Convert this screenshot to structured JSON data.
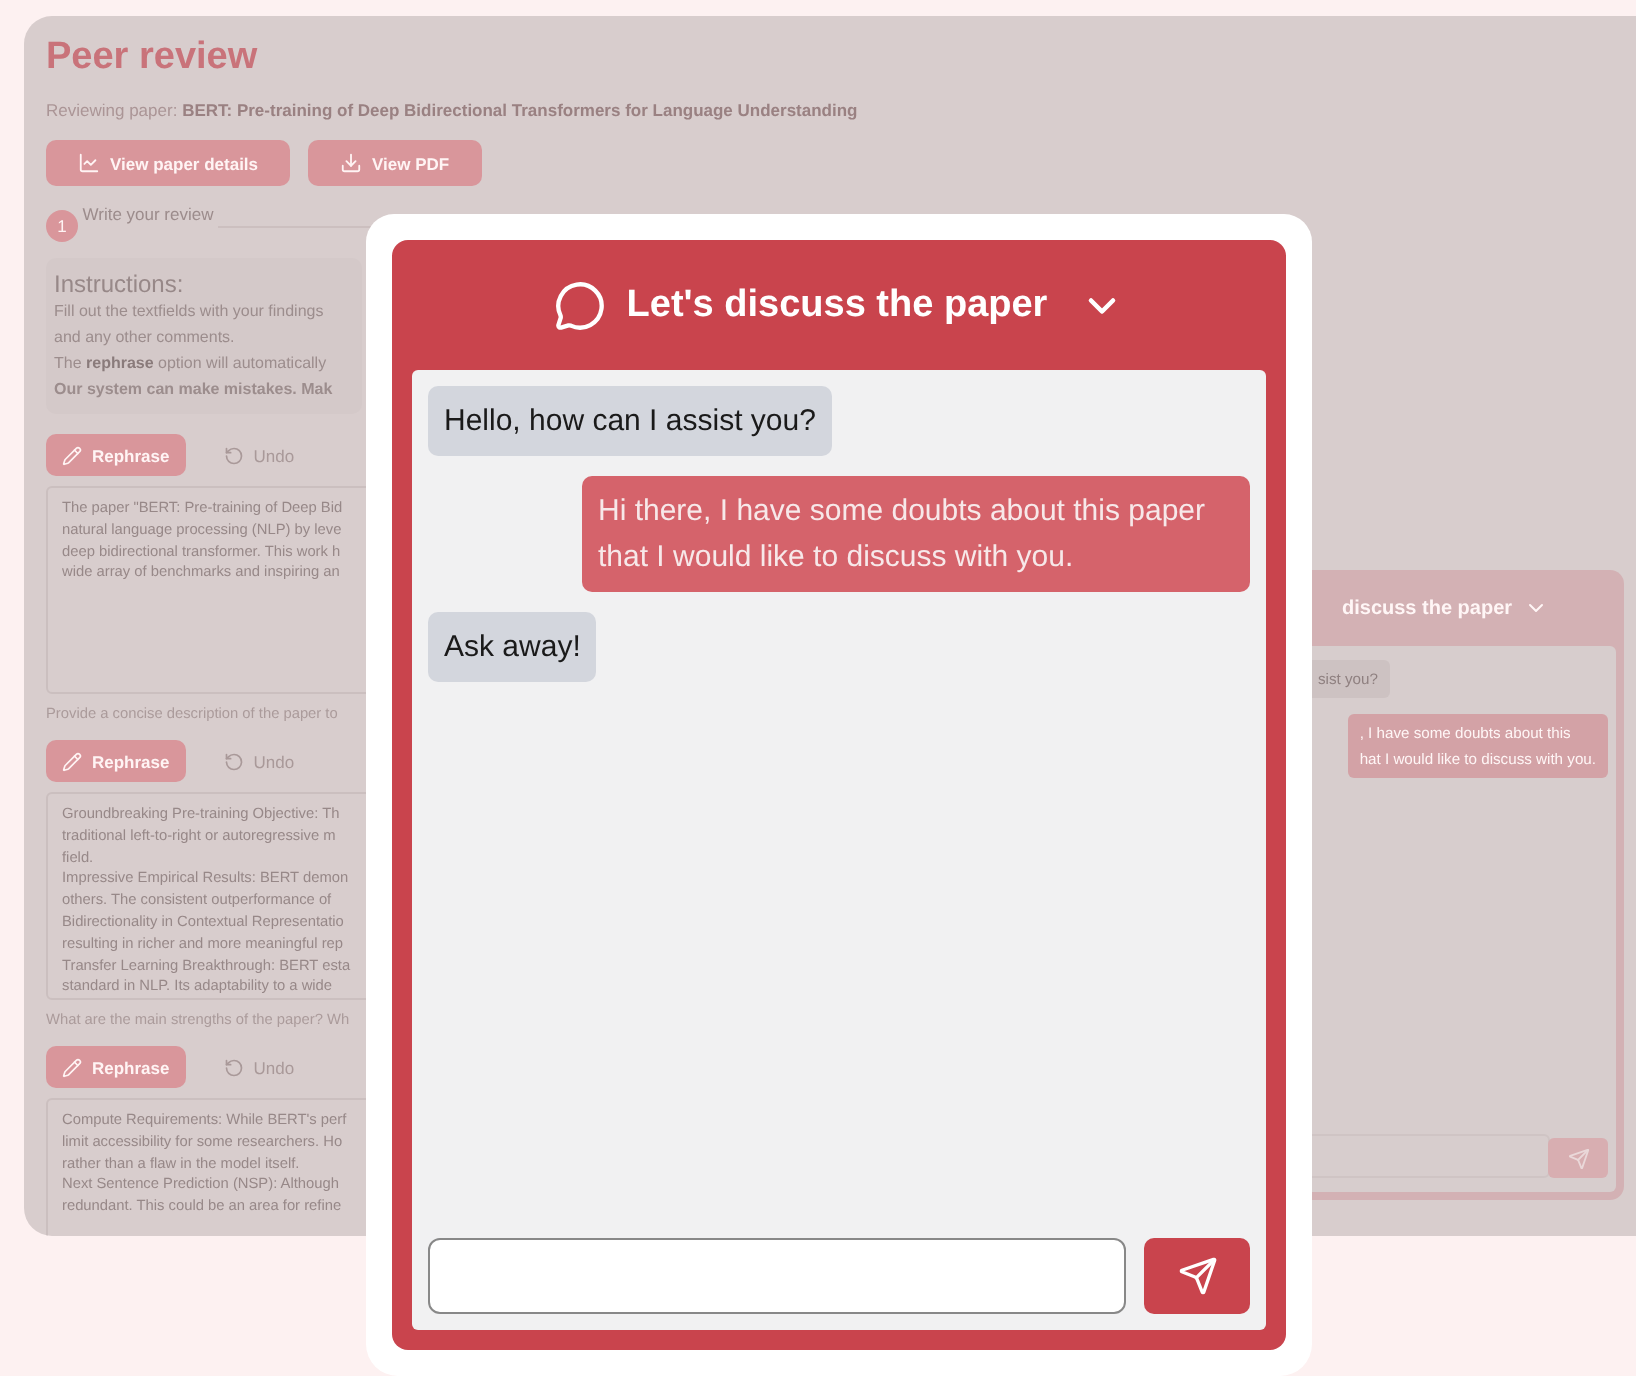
{
  "page": {
    "title": "Peer review",
    "subtitle": {
      "label": "Reviewing paper:",
      "paper": "BERT: Pre-training of Deep Bidirectional Transformers for Language Understanding"
    },
    "buttons": [
      {
        "kind": "chart",
        "label": "View paper details"
      },
      {
        "kind": "download",
        "label": "View PDF"
      }
    ],
    "steps": [
      {
        "number": "1",
        "label": "Write your review"
      }
    ],
    "instructions": {
      "heading": "Instructions:",
      "lines": [
        {
          "text": "Fill out the textfields with your findings",
          "bold": false
        },
        {
          "text": "and any other comments.",
          "bold": false
        },
        {
          "text": "The **rephrase** option will automatically",
          "bold": false
        },
        {
          "text": "Our system can make mistakes. Mak",
          "bold": true
        }
      ]
    },
    "sections": [
      {
        "rephrase": "Rephrase",
        "undo": "Undo",
        "lines": [
          "The paper \"BERT: Pre-training of Deep Bid",
          "natural language processing (NLP) by leve",
          "deep bidirectional transformer. This work h",
          "wide array of benchmarks and inspiring an"
        ],
        "hint": "Provide a concise description of the paper to"
      },
      {
        "rephrase": "Rephrase",
        "undo": "Undo",
        "lines": [
          "Groundbreaking Pre-training Objective: Th",
          "traditional left-to-right or autoregressive m",
          "field.",
          "Impressive Empirical Results: BERT demon",
          "others. The consistent outperformance of",
          "Bidirectionality in Contextual Representatio",
          "resulting in richer and more meaningful rep",
          "Transfer Learning Breakthrough: BERT esta",
          "standard in NLP. Its adaptability to a wide"
        ],
        "hint": "What are the main strengths of the paper? Wh"
      },
      {
        "rephrase": "Rephrase",
        "undo": "Undo",
        "lines": [
          "Compute Requirements: While BERT's perf",
          "limit accessibility for some researchers. Ho",
          "rather than a flaw in the model itself.",
          "Next Sentence Prediction (NSP): Although",
          "redundant. This could be an area for refine"
        ]
      }
    ],
    "side_chat": {
      "title": "discuss the paper",
      "messages": [
        {
          "kind": "bot",
          "lines": [
            "sist you?"
          ]
        },
        {
          "kind": "user",
          "lines": [
            ", I have some doubts about this",
            "hat I would like to discuss with you."
          ]
        }
      ]
    }
  },
  "chat": {
    "title": "Let's discuss the paper",
    "messages": [
      {
        "kind": "bot",
        "text": "Hello, how can I assist you?"
      },
      {
        "kind": "user",
        "text": "Hi there, I have some doubts about this paper that I would like to discuss with you."
      },
      {
        "kind": "bot",
        "text": "Ask away!"
      }
    ]
  }
}
